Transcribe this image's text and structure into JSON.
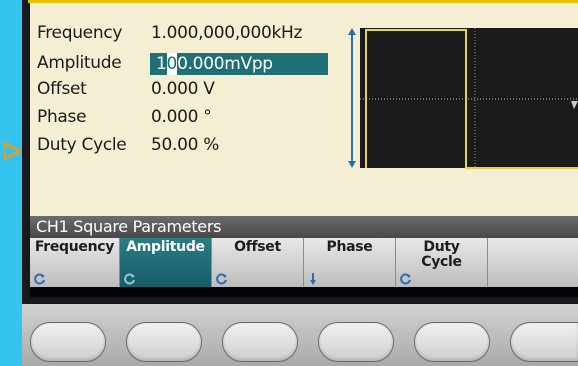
{
  "parameters": [
    {
      "label": "Frequency",
      "value": "1.000,000,000kHz"
    },
    {
      "label": "Amplitude",
      "value_prefix": "1",
      "value_cursor": "0",
      "value_suffix": "0.000mVpp"
    },
    {
      "label": "Offset",
      "value": "0.000 V"
    },
    {
      "label": "Phase",
      "value": "0.000 °"
    },
    {
      "label": "Duty Cycle",
      "value": "50.00 %"
    }
  ],
  "panel_title": "CH1 Square Parameters",
  "softkeys": [
    {
      "line1": "Frequency",
      "line2": "",
      "icon": "knob-icon",
      "selected": false
    },
    {
      "line1": "Amplitude",
      "line2": "",
      "icon": "knob-icon",
      "selected": true
    },
    {
      "line1": "Offset",
      "line2": "",
      "icon": "knob-icon",
      "selected": false
    },
    {
      "line1": "Phase",
      "line2": "",
      "icon": "down-arrow-icon",
      "selected": false
    },
    {
      "line1": "Duty",
      "line2": "Cycle",
      "icon": "knob-icon",
      "selected": false
    },
    {
      "line1": "",
      "line2": "",
      "icon": "",
      "selected": false
    }
  ],
  "colors": {
    "screen_bg": "#f4eed2",
    "highlight": "#1f6f78",
    "waveform": "#e6d34a",
    "marker": "#2a6fb0",
    "accent_band": "#35c3ef",
    "arrow": "#f29a1a"
  }
}
